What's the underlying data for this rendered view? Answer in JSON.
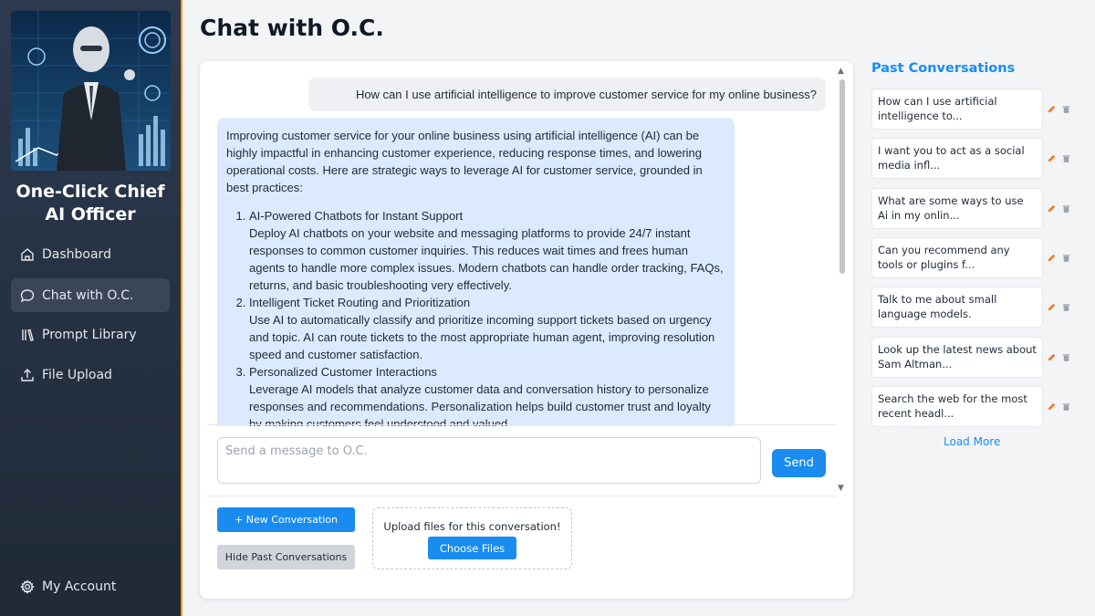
{
  "app": {
    "brand_line1": "One-Click Chief",
    "brand_line2": "AI Officer"
  },
  "sidebar": {
    "items": [
      {
        "label": "Dashboard",
        "icon": "home-icon"
      },
      {
        "label": "Chat with O.C.",
        "icon": "chat-bubble-icon",
        "active": true
      },
      {
        "label": "Prompt Library",
        "icon": "library-icon"
      },
      {
        "label": "File Upload",
        "icon": "upload-icon"
      }
    ],
    "account_label": "My Account",
    "account_icon": "gear-icon"
  },
  "page": {
    "title": "Chat with O.C."
  },
  "chat": {
    "user_message": "How can I use artificial intelligence to improve customer service for my online business?",
    "ai_intro": "Improving customer service for your online business using artificial intelligence (AI) can be highly impactful in enhancing customer experience, reducing response times, and lowering operational costs. Here are strategic ways to leverage AI for customer service, grounded in best practices:",
    "ai_points": [
      {
        "title": "AI-Powered Chatbots for Instant Support",
        "body": "Deploy AI chatbots on your website and messaging platforms to provide 24/7 instant responses to common customer inquiries. This reduces wait times and frees human agents to handle more complex issues. Modern chatbots can handle order tracking, FAQs, returns, and basic troubleshooting very effectively."
      },
      {
        "title": "Intelligent Ticket Routing and Prioritization",
        "body": "Use AI to automatically classify and prioritize incoming support tickets based on urgency and topic. AI can route tickets to the most appropriate human agent, improving resolution speed and customer satisfaction."
      },
      {
        "title": "Personalized Customer Interactions",
        "body": "Leverage AI models that analyze customer data and conversation history to personalize responses and recommendations. Personalization helps build customer trust and loyalty by making customers feel understood and valued."
      }
    ],
    "input_placeholder": "Send a message to O.C.",
    "input_value": "",
    "send_label": "Send",
    "new_conversation_label": "+ New Conversation",
    "hide_past_label": "Hide Past Conversations",
    "upload_prompt": "Upload files for this conversation!",
    "choose_files_label": "Choose Files"
  },
  "past": {
    "title": "Past Conversations",
    "items": [
      "How can I use artificial intelligence to...",
      "I want you to act as a social media infl...",
      "What are some ways to use Ai in my onlin...",
      "Can you recommend any tools or plugins f...",
      "Talk to me about small language models.",
      "Look up the latest news about Sam Altman...",
      "Search the web for the most recent headl..."
    ],
    "load_more_label": "Load More",
    "edit_icon": "pencil-icon",
    "delete_icon": "trash-icon"
  },
  "colors": {
    "accent": "#1a8cf0",
    "sidebar_bg": "#243042",
    "sidebar_border": "#f59e0b",
    "ai_bubble": "#dbeafe",
    "user_bubble": "#eef0f3",
    "edit_icon": "#f97316"
  }
}
